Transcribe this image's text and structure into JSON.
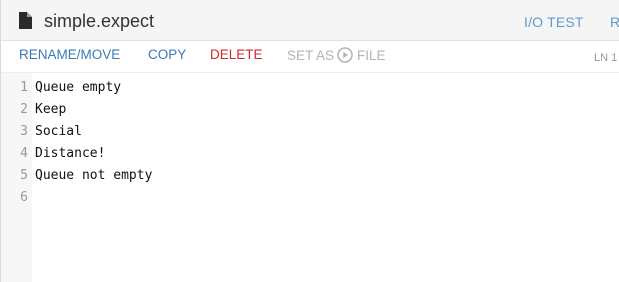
{
  "file": {
    "name": "simple.expect",
    "icon": "file-icon"
  },
  "header": {
    "io_test": "I/O TEST",
    "run_cut": "R"
  },
  "toolbar": {
    "rename": "RENAME/MOVE",
    "copy": "COPY",
    "delete": "DELETE",
    "set_as_prefix": "SET AS",
    "set_as_icon": "play-circle-icon",
    "set_as_suffix": "FILE",
    "ln_indicator": "LN 1"
  },
  "editor": {
    "lines": [
      {
        "num": "1",
        "text": "Queue empty"
      },
      {
        "num": "2",
        "text": "Keep"
      },
      {
        "num": "3",
        "text": "Social"
      },
      {
        "num": "4",
        "text": "Distance!"
      },
      {
        "num": "5",
        "text": "Queue not empty"
      },
      {
        "num": "6",
        "text": ""
      }
    ]
  },
  "colors": {
    "link": "#3a7ab5",
    "delete": "#cc2b2b",
    "disabled": "#b3b3b3",
    "header_link": "#5b9bd5"
  }
}
